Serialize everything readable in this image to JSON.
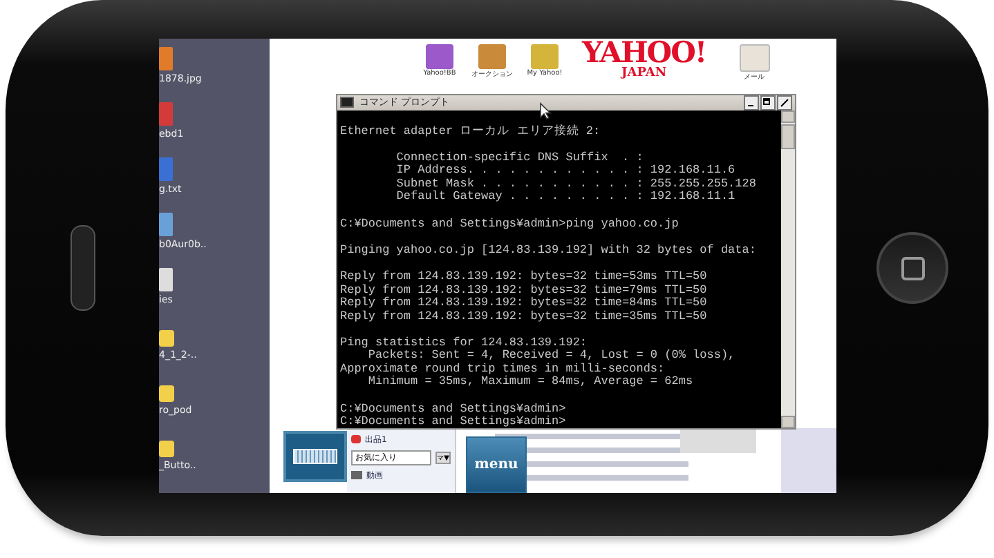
{
  "desktop": {
    "icons": [
      {
        "kind": "image",
        "label": "1878.jpg"
      },
      {
        "kind": "pdf",
        "label": "ebd1"
      },
      {
        "kind": "document",
        "label": "g.txt"
      },
      {
        "kind": "shortcut",
        "label": "b0Aur0b.."
      },
      {
        "kind": "settings",
        "label": "ies"
      },
      {
        "kind": "folder",
        "label": "4_1_2-.."
      },
      {
        "kind": "folder",
        "label": "ro_pod"
      },
      {
        "kind": "folder",
        "label": "_Butto.."
      }
    ]
  },
  "browser": {
    "services": [
      {
        "kind": "bb",
        "label": "Yahoo!BB"
      },
      {
        "kind": "auction",
        "label": "オークション"
      },
      {
        "kind": "my",
        "label": "My Yahoo!"
      }
    ],
    "logo": {
      "name": "YAHOO!",
      "region": "JAPAN"
    },
    "mail": {
      "label": "メール"
    },
    "sidebar": [
      {
        "kind": "tag",
        "label": "出品1"
      },
      {
        "kind": "dropdown",
        "label": "お気に入り",
        "button": "マ▼"
      },
      {
        "kind": "video",
        "label": "動画"
      }
    ]
  },
  "console": {
    "title": "コマンド プロンプト",
    "blocks": [
      [
        "Ethernet adapter ローカル エリア接続 2:"
      ],
      [
        "        Connection-specific DNS Suffix  . :",
        "        IP Address. . . . . . . . . . . . : 192.168.11.6",
        "        Subnet Mask . . . . . . . . . . . : 255.255.255.128",
        "        Default Gateway . . . . . . . . . : 192.168.11.1"
      ],
      [
        "C:¥Documents and Settings¥admin>ping yahoo.co.jp"
      ],
      [
        "Pinging yahoo.co.jp [124.83.139.192] with 32 bytes of data:"
      ],
      [
        "Reply from 124.83.139.192: bytes=32 time=53ms TTL=50",
        "Reply from 124.83.139.192: bytes=32 time=79ms TTL=50",
        "Reply from 124.83.139.192: bytes=32 time=84ms TTL=50",
        "Reply from 124.83.139.192: bytes=32 time=35ms TTL=50"
      ],
      [
        "Ping statistics for 124.83.139.192:",
        "    Packets: Sent = 4, Received = 4, Lost = 0 (0% loss),",
        "Approximate round trip times in milli-seconds:",
        "    Minimum = 35ms, Maximum = 84ms, Average = 62ms"
      ],
      [
        "C:¥Documents and Settings¥admin>",
        "C:¥Documents and Settings¥admin>"
      ]
    ]
  },
  "overlay": {
    "menu_button": "menu"
  }
}
